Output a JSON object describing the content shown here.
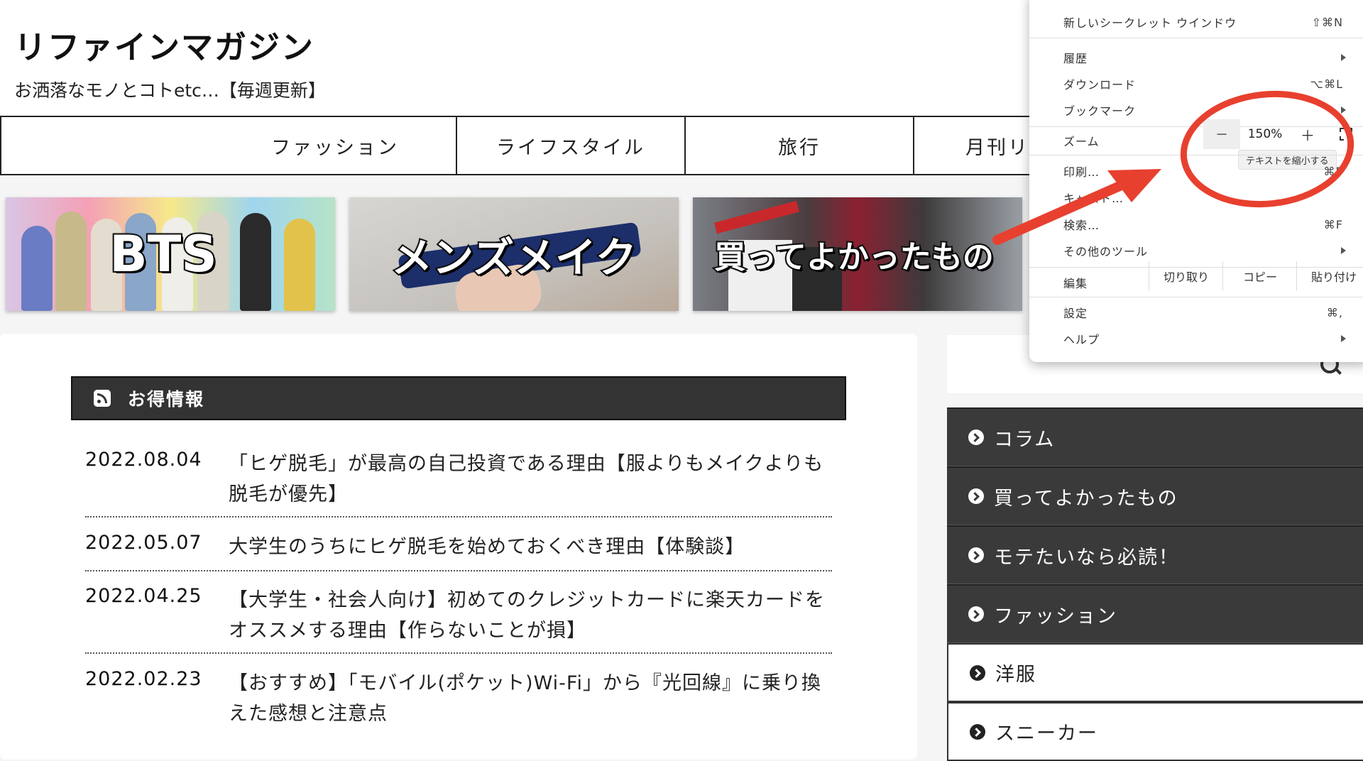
{
  "site": {
    "title": "リファインマガジン",
    "tagline": "お洒落なモノとコトetc…【毎週更新】"
  },
  "nav": [
    "ファッション",
    "ライフスタイル",
    "旅行",
    "月刊リ"
  ],
  "banners": [
    "BTS",
    "メンズメイク",
    "買ってよかったもの"
  ],
  "section": {
    "title": "お得情報",
    "icon": "rss-icon"
  },
  "news": [
    {
      "date": "2022.08.04",
      "title": "「ヒゲ脱毛」が最高の自己投資である理由【服よりもメイクよりも脱毛が優先】"
    },
    {
      "date": "2022.05.07",
      "title": "大学生のうちにヒゲ脱毛を始めておくべき理由【体験談】"
    },
    {
      "date": "2022.04.25",
      "title": "【大学生・社会人向け】初めてのクレジットカードに楽天カードをオススメする理由【作らないことが損】"
    },
    {
      "date": "2022.02.23",
      "title": "【おすすめ】「モバイル(ポケット)Wi-Fi」から『光回線』に乗り換えた感想と注意点"
    }
  ],
  "sidebar": {
    "search_icon": "search-icon",
    "items": [
      "コラム",
      "買ってよかったもの",
      "モテたいなら必読！",
      "ファッション",
      "洋服",
      "スニーカー"
    ]
  },
  "menu": {
    "incognito": {
      "label": "新しいシークレット ウインドウ",
      "shortcut": "⇧⌘N"
    },
    "history": "履歴",
    "downloads": {
      "label": "ダウンロード",
      "shortcut": "⌥⌘L"
    },
    "bookmarks": "ブックマーク",
    "zoom": {
      "label": "ズーム",
      "minus": "－",
      "value": "150%",
      "plus": "＋",
      "tooltip": "テキストを縮小する"
    },
    "print": {
      "label": "印刷…",
      "shortcut": "⌘P"
    },
    "cast": "キャスト…",
    "find": {
      "label": "検索…",
      "shortcut": "⌘F"
    },
    "more_tools": "その他のツール",
    "edit": {
      "label": "編集",
      "cut": "切り取り",
      "copy": "コピー",
      "paste": "貼り付け"
    },
    "settings": {
      "label": "設定",
      "shortcut": "⌘,"
    },
    "help": "ヘルプ"
  },
  "colors": {
    "annotation": "#e8402f",
    "dark_panel": "#3a3a3a"
  }
}
